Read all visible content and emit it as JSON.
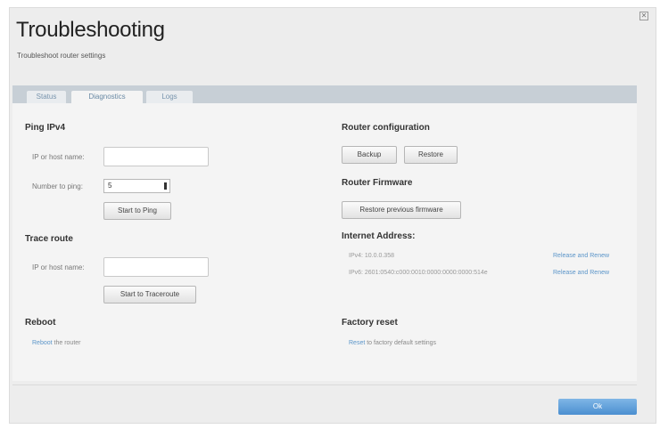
{
  "header": {
    "title": "Troubleshooting",
    "subtitle": "Troubleshoot router settings"
  },
  "tabs": [
    {
      "label": "Status",
      "active": false
    },
    {
      "label": "Diagnostics",
      "active": true
    },
    {
      "label": "Logs",
      "active": false
    }
  ],
  "ping": {
    "title": "Ping IPv4",
    "host_label": "IP or host name:",
    "host_value": "",
    "count_label": "Number to ping:",
    "count_value": "5",
    "start_label": "Start to Ping"
  },
  "trace": {
    "title": "Trace route",
    "host_label": "IP or host name:",
    "host_value": "",
    "start_label": "Start to Traceroute"
  },
  "reboot": {
    "title": "Reboot",
    "link": "Reboot",
    "text": " the router"
  },
  "router_config": {
    "title": "Router configuration",
    "backup_label": "Backup",
    "restore_label": "Restore"
  },
  "firmware": {
    "title": "Router Firmware",
    "restore_prev_label": "Restore previous firmware"
  },
  "internet": {
    "title": "Internet Address:",
    "ipv4": "IPv4: 10.0.0.358",
    "ipv6": "IPv6: 2601:0540:c000:0010:0000:0000:0000:514e",
    "release_label": "Release and Renew"
  },
  "factory": {
    "title": "Factory reset",
    "link": "Reset",
    "text": " to factory default settings"
  },
  "footer": {
    "ok_label": "Ok"
  },
  "colors": {
    "accent": "#4b8fd0",
    "link": "#5b95c9",
    "tabbar": "#c7cfd6"
  }
}
